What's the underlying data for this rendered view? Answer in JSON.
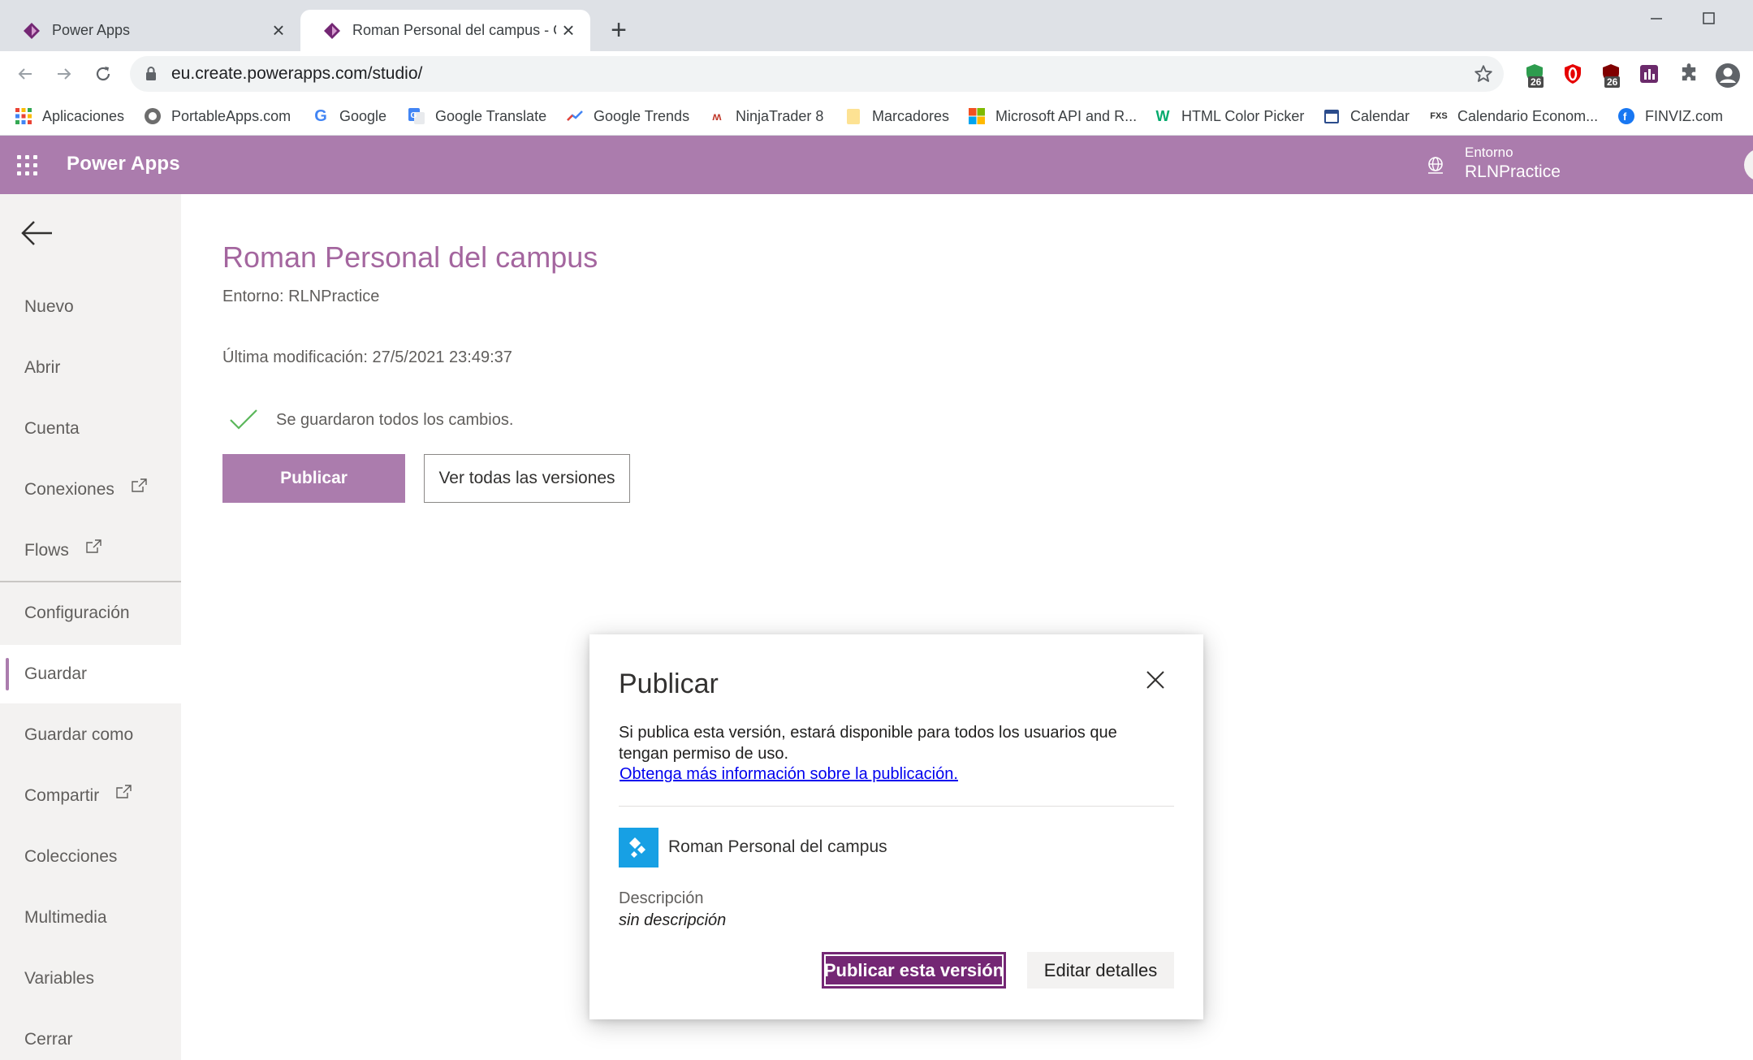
{
  "browser": {
    "tabs": [
      {
        "title": "Power Apps",
        "active": false
      },
      {
        "title": "Roman Personal del campus - Gu",
        "active": true
      }
    ],
    "new_tab_label": "+",
    "url": "eu.create.powerapps.com/studio/",
    "extensions": [
      {
        "name": "shield-extension-icon",
        "badge": "26",
        "color": "#2e9c4e"
      },
      {
        "name": "opera-extension-icon",
        "badge": "",
        "color": "#e60000"
      },
      {
        "name": "ublock-extension-icon",
        "badge": "26",
        "color": "#800000"
      },
      {
        "name": "chart-extension-icon",
        "badge": "",
        "color": "#6b2a6b"
      },
      {
        "name": "puzzle-extensions-icon",
        "badge": "",
        "color": "#5f6368"
      }
    ],
    "bookmarks": [
      {
        "label": "Aplicaciones",
        "icon": "apps-grid-icon"
      },
      {
        "label": "PortableApps.com",
        "icon": "portableapps-icon"
      },
      {
        "label": "Google",
        "icon": "google-icon"
      },
      {
        "label": "Google Translate",
        "icon": "google-translate-icon"
      },
      {
        "label": "Google Trends",
        "icon": "google-trends-icon"
      },
      {
        "label": "NinjaTrader 8",
        "icon": "ninjatrader-icon"
      },
      {
        "label": "Marcadores",
        "icon": "folder-icon"
      },
      {
        "label": "Microsoft API and R...",
        "icon": "microsoft-icon"
      },
      {
        "label": "HTML Color Picker",
        "icon": "w3schools-icon"
      },
      {
        "label": "Calendar",
        "icon": "calendar-icon"
      },
      {
        "label": "Calendario Econom...",
        "icon": "fxs-icon"
      },
      {
        "label": "FINVIZ.com",
        "icon": "finviz-icon"
      }
    ]
  },
  "header": {
    "app_name": "Power Apps",
    "environment_label": "Entorno",
    "environment_value": "RLNPractice",
    "brand_color": "#ab7cad"
  },
  "sidebar": {
    "items": [
      {
        "label": "Nuevo",
        "external": false,
        "selected": false
      },
      {
        "label": "Abrir",
        "external": false,
        "selected": false
      },
      {
        "label": "Cuenta",
        "external": false,
        "selected": false
      },
      {
        "label": "Conexiones",
        "external": true,
        "selected": false
      },
      {
        "label": "Flows",
        "external": true,
        "selected": false
      },
      {
        "label": "Configuración",
        "external": false,
        "selected": false
      },
      {
        "label": "Guardar",
        "external": false,
        "selected": true
      },
      {
        "label": "Guardar como",
        "external": false,
        "selected": false
      },
      {
        "label": "Compartir",
        "external": true,
        "selected": false
      },
      {
        "label": "Colecciones",
        "external": false,
        "selected": false
      },
      {
        "label": "Multimedia",
        "external": false,
        "selected": false
      },
      {
        "label": "Variables",
        "external": false,
        "selected": false
      },
      {
        "label": "Cerrar",
        "external": false,
        "selected": false
      }
    ]
  },
  "main": {
    "title": "Roman Personal del campus",
    "environment": "Entorno: RLNPractice",
    "last_modified": "Última modificación: 27/5/2021 23:49:37",
    "saved_status": "Se guardaron todos los cambios.",
    "publish_button": "Publicar",
    "versions_button": "Ver todas las versiones"
  },
  "dialog": {
    "title": "Publicar",
    "body": "Si publica esta versión, estará disponible para todos los usuarios que tengan permiso de uso.",
    "link": "Obtenga más información sobre la publicación.",
    "app_name": "Roman Personal del campus",
    "description_label": "Descripción",
    "description_value": "sin descripción",
    "primary_button": "Publicar esta versión",
    "secondary_button": "Editar detalles",
    "primary_color": "#742774"
  }
}
